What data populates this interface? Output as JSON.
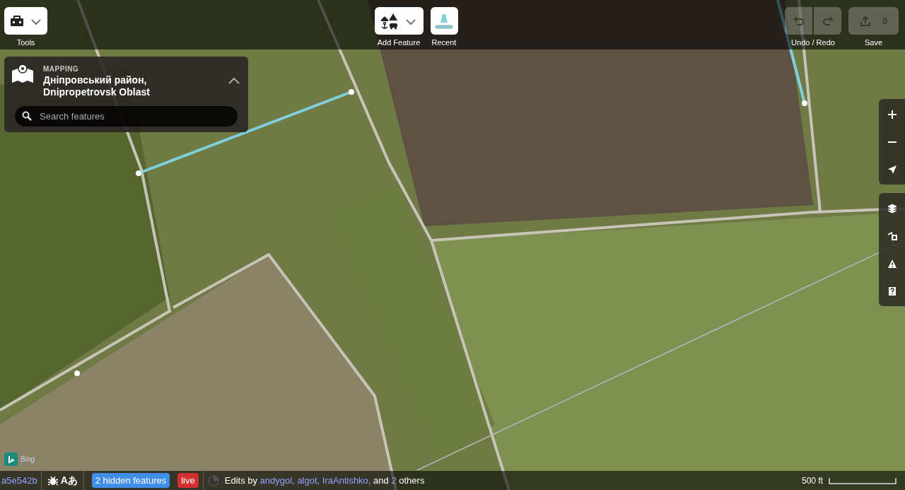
{
  "toolbar": {
    "tools": {
      "label": "Tools"
    },
    "add_feature": {
      "label": "Add Feature"
    },
    "recent": {
      "label": "Recent"
    },
    "undo_redo": {
      "label": "Undo / Redo",
      "disabled": true
    },
    "save": {
      "label": "Save",
      "count": "0",
      "disabled": true
    }
  },
  "location_panel": {
    "heading": "MAPPING",
    "title": "Дніпровський район, Dnipropetrovsk Oblast",
    "expanded": true,
    "search": {
      "placeholder": "Search features"
    }
  },
  "map_controls": {
    "navigation": [
      {
        "kind": "zoom_in"
      },
      {
        "kind": "zoom_out"
      },
      {
        "kind": "locate"
      }
    ],
    "panes": [
      {
        "kind": "layers"
      },
      {
        "kind": "map_data"
      },
      {
        "kind": "issues"
      },
      {
        "kind": "help"
      }
    ]
  },
  "imagery": {
    "attribution": "Bing"
  },
  "footer": {
    "version": "a5e542b",
    "language": "Aあ",
    "hidden_features": "2 hidden features",
    "live": "live",
    "edits": {
      "prefix": "Edits by",
      "users": [
        "andygol,",
        "algot,",
        "IraAntishko,"
      ],
      "conjunction": "and",
      "count": "2",
      "suffix": "others"
    },
    "scale": "500 ft"
  }
}
